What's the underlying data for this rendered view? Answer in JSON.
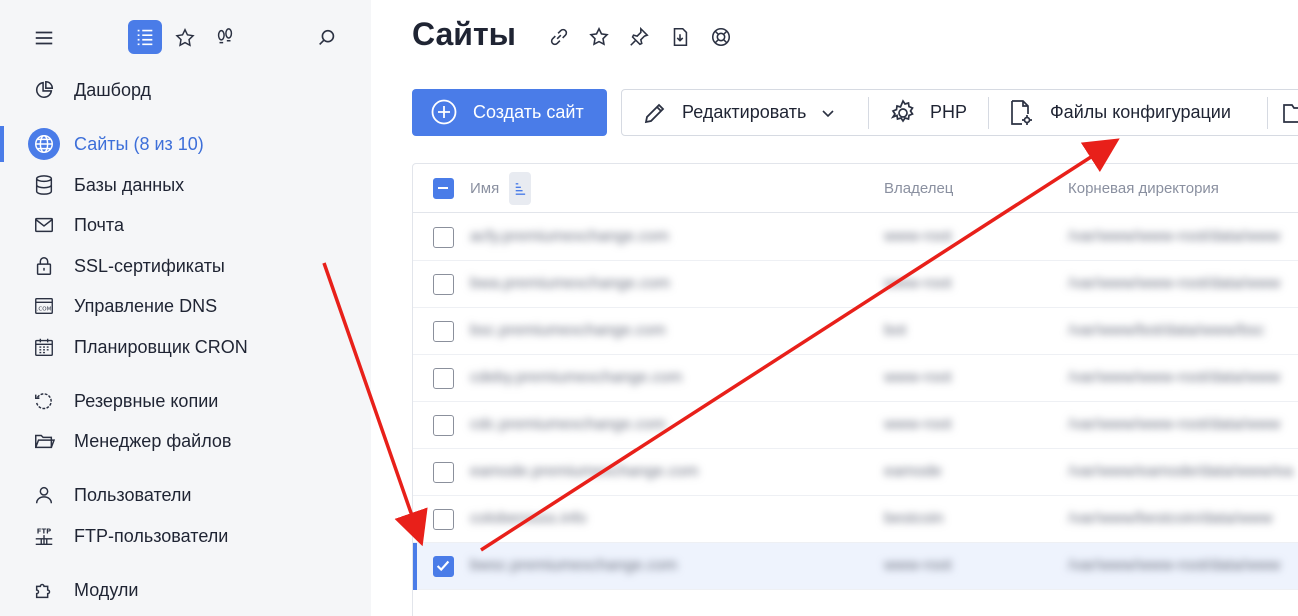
{
  "sidebar": {
    "items": [
      {
        "label": "Дашборд",
        "icon": "dashboard-pie-icon"
      },
      {
        "label": "Сайты (8 из 10)",
        "icon": "globe-icon",
        "active": true
      },
      {
        "label": "Базы данных",
        "icon": "database-icon"
      },
      {
        "label": "Почта",
        "icon": "mail-icon"
      },
      {
        "label": "SSL-сертификаты",
        "icon": "lock-icon"
      },
      {
        "label": "Управление DNS",
        "icon": "dns-icon"
      },
      {
        "label": "Планировщик CRON",
        "icon": "calendar-icon"
      },
      {
        "label": "Резервные копии",
        "icon": "backup-icon"
      },
      {
        "label": "Менеджер файлов",
        "icon": "folder-icon"
      },
      {
        "label": "Пользователи",
        "icon": "user-icon"
      },
      {
        "label": "FTP-пользователи",
        "icon": "ftp-icon"
      },
      {
        "label": "Модули",
        "icon": "puzzle-icon"
      }
    ],
    "ftp_icon_text": "FTP",
    "dns_icon_text": ".COM"
  },
  "main": {
    "title": "Сайты",
    "create_button": "Создать сайт",
    "toolbar": {
      "edit": "Редактировать",
      "php": "PHP",
      "config_files": "Файлы конфигурации"
    },
    "table": {
      "columns": [
        "Имя",
        "Владелец",
        "Корневая директория"
      ],
      "rows": [
        {
          "name": "acfy.premiumexchange.com",
          "owner": "www-root",
          "root": "/var/www/www-root/data/www",
          "checked": false
        },
        {
          "name": "bwa.premiumexchange.com",
          "owner": "www-root",
          "root": "/var/www/www-root/data/www",
          "checked": false
        },
        {
          "name": "bsc.premiumexchange.com",
          "owner": "bot",
          "root": "/var/www/bot/data/www/bsc",
          "checked": false
        },
        {
          "name": "cdeby.premiumexchange.com",
          "owner": "www-root",
          "root": "/var/www/www-root/data/www",
          "checked": false
        },
        {
          "name": "cdc.premiumexchange.com",
          "owner": "www-root",
          "root": "/var/www/www-root/data/www",
          "checked": false
        },
        {
          "name": "eamode.premiumexchange.com",
          "owner": "eamode",
          "root": "/var/www/eamode/data/www/ea",
          "checked": false
        },
        {
          "name": "coloberouss.info",
          "owner": "bestcoin",
          "root": "/var/www/bestcoin/data/www",
          "checked": false
        },
        {
          "name": "bwsc.premiumexchange.com",
          "owner": "www-root",
          "root": "/var/www/www-root/data/www",
          "checked": true
        }
      ]
    }
  },
  "colors": {
    "accent": "#4a7ce8",
    "annotation_arrow": "#e8201a"
  }
}
